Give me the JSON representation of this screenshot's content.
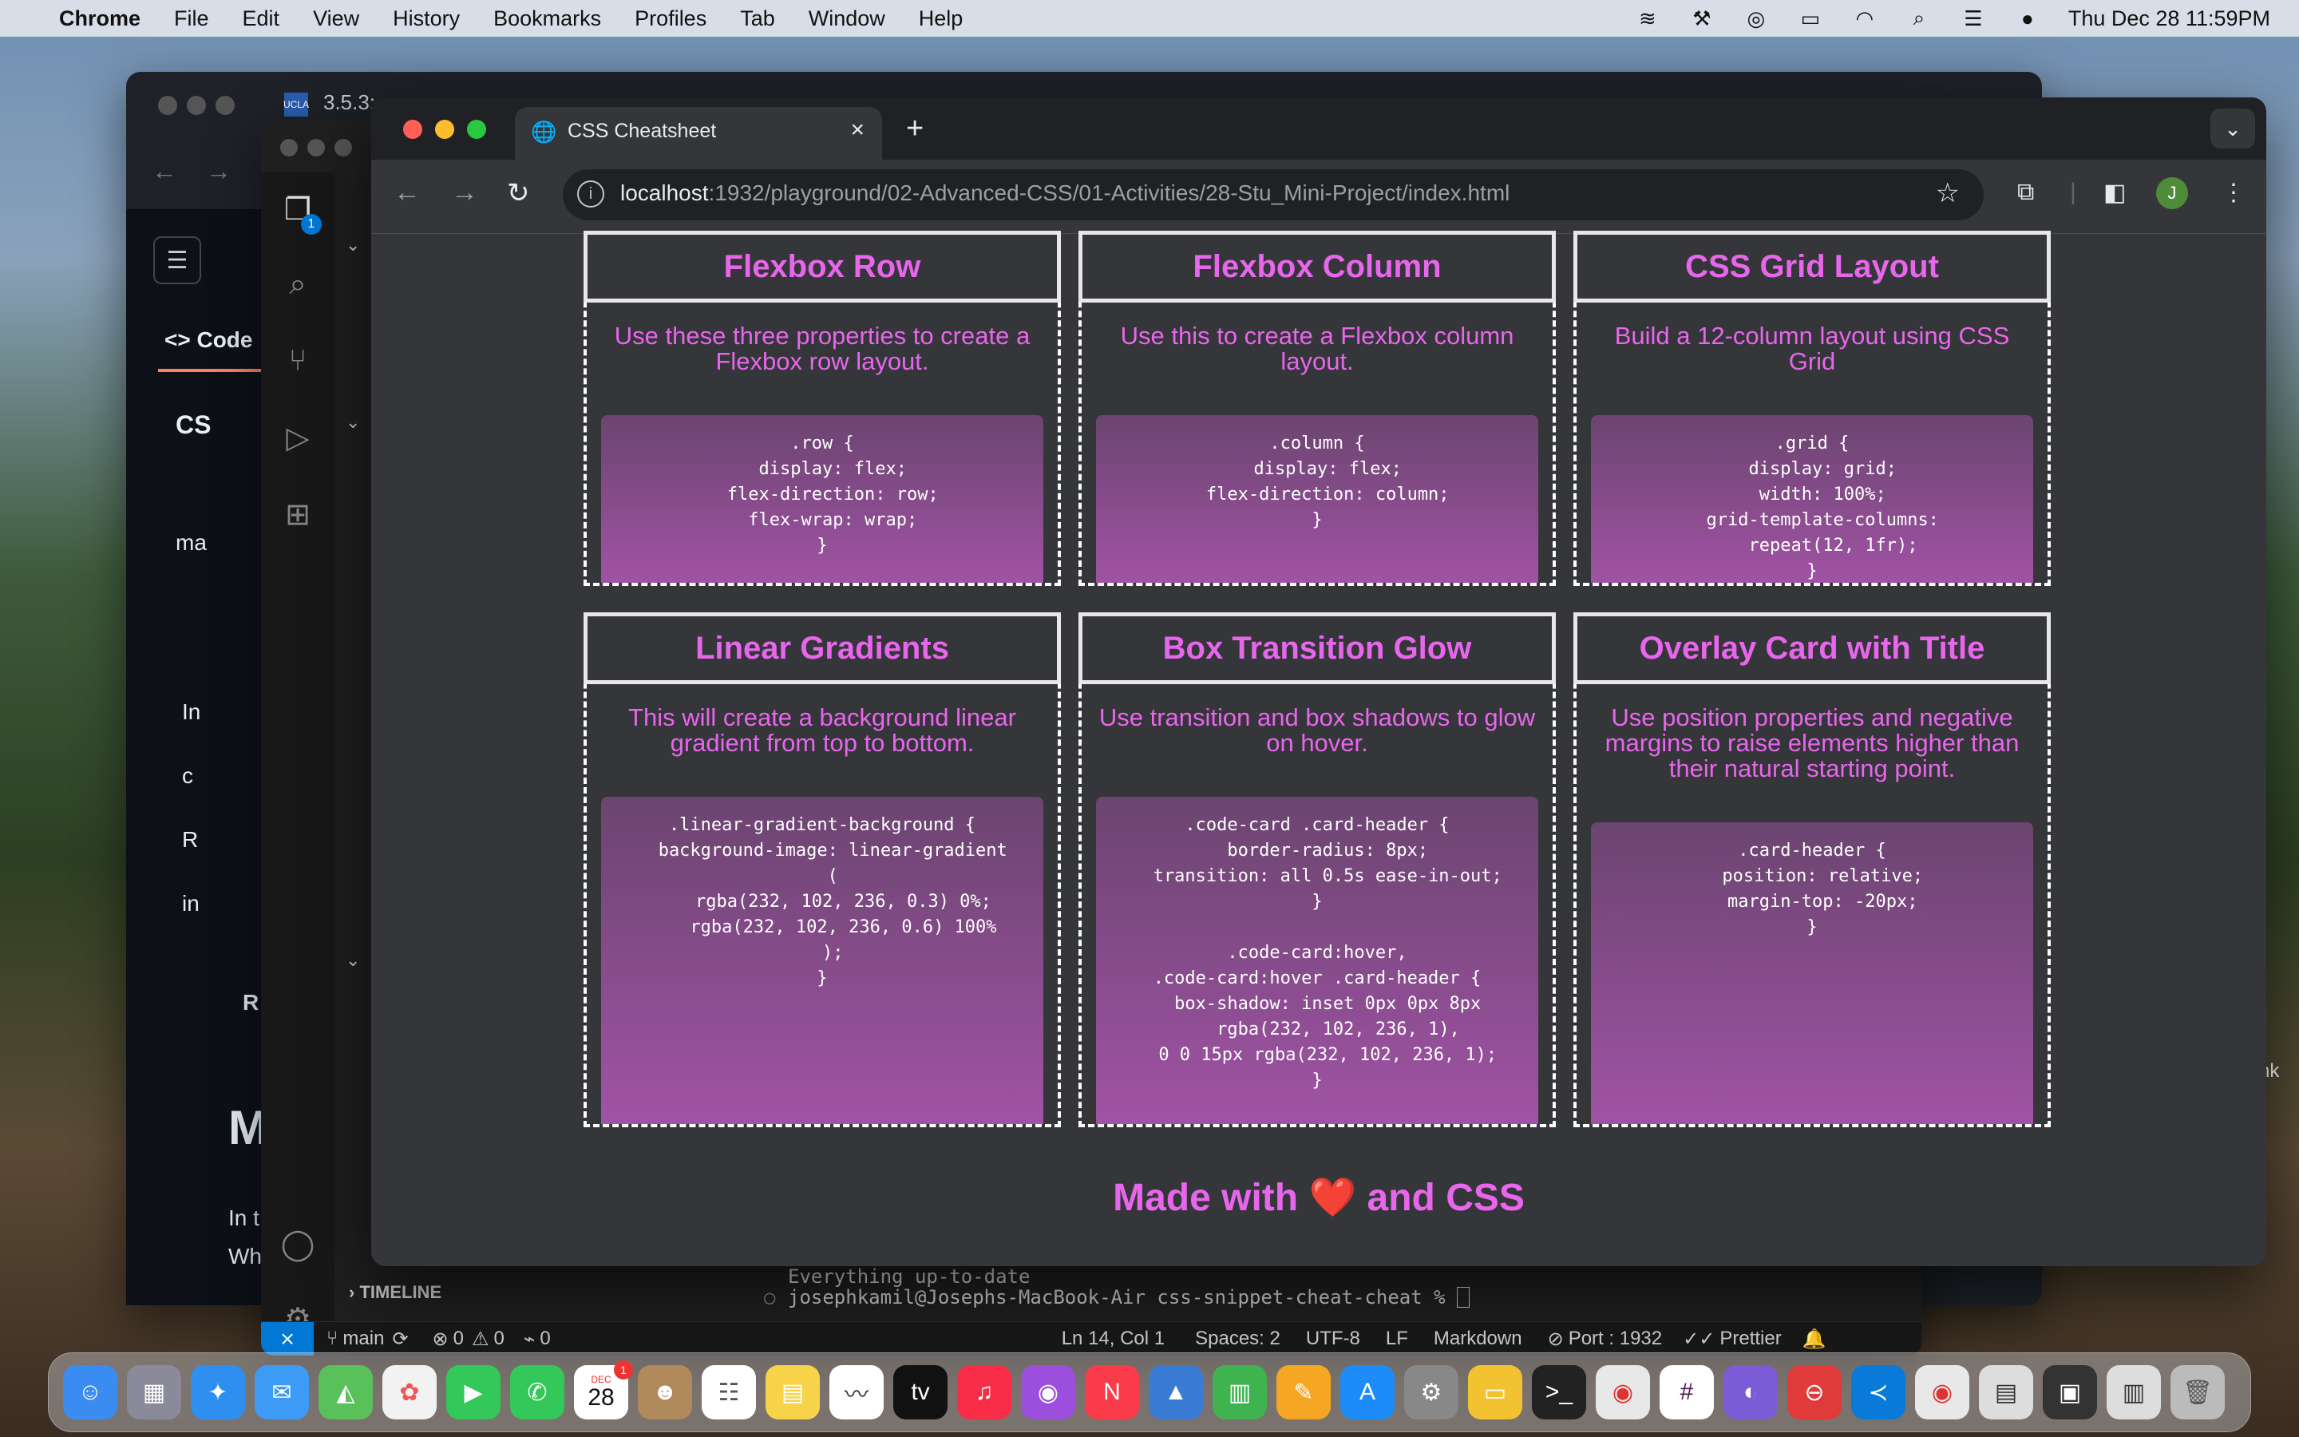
{
  "menubar": {
    "app": "Chrome",
    "items": [
      "File",
      "Edit",
      "View",
      "History",
      "Bookmarks",
      "Profiles",
      "Tab",
      "Window",
      "Help"
    ],
    "datetime": "Thu Dec 28  11:59PM"
  },
  "background_windows": {
    "tab_text": "3.5.3:",
    "github_code_tab": "Code",
    "github_repo_prefix": "CS",
    "github_branch_prefix": "ma",
    "github_files": [
      "In",
      "c",
      "R",
      "in"
    ],
    "github_readme_prefix": "R",
    "github_heading_prefix": "M",
    "github_text_1": "In t",
    "github_text_2": "Wh",
    "right_edge_text": "nk"
  },
  "vscode": {
    "explorer_badge": "1",
    "timeline_label": "TIMELINE",
    "terminal_line_1": "Everything up-to-date",
    "terminal_line_2": "josephkamil@Josephs-MacBook-Air css-snippet-cheat-cheat % ",
    "status": {
      "branch": "main",
      "errors": "0",
      "warnings": "0",
      "ports": "0",
      "position": "Ln 14, Col 1",
      "spaces": "Spaces: 2",
      "encoding": "UTF-8",
      "eol": "LF",
      "language": "Markdown",
      "port": "Port : 1932",
      "formatter": "Prettier"
    }
  },
  "chrome": {
    "tab_title": "CSS Cheatsheet",
    "url_host": "localhost",
    "url_path": ":1932/playground/02-Advanced-CSS/01-Activities/28-Stu_Mini-Project/index.html",
    "profile_initial": "J"
  },
  "cards": [
    {
      "title": "Flexbox Row",
      "desc": "Use these three properties to create a Flexbox row layout.",
      "code": ".row {\n  display: flex;\n  flex-direction: row;\n  flex-wrap: wrap;\n}"
    },
    {
      "title": "Flexbox Column",
      "desc": "Use this to create a Flexbox column layout.",
      "code": ".column {\n  display: flex;\n  flex-direction: column;\n}"
    },
    {
      "title": "CSS Grid Layout",
      "desc": "Build a 12-column layout using CSS Grid",
      "code": ".grid {\n  display: grid;\n  width: 100%;\n  grid-template-columns:\n    repeat(12, 1fr);\n}"
    },
    {
      "title": "Linear Gradients",
      "desc": "This will create a background linear gradient from top to bottom.",
      "code": ".linear-gradient-background {\n  background-image: linear-gradient\n  (\n    rgba(232, 102, 236, 0.3) 0%;\n    rgba(232, 102, 236, 0.6) 100%\n  );\n}"
    },
    {
      "title": "Box Transition Glow",
      "desc": "Use transition and box shadows to glow on hover.",
      "code": ".code-card .card-header {\n  border-radius: 8px;\n  transition: all 0.5s ease-in-out;\n}\n\n.code-card:hover,\n.code-card:hover .card-header {\n  box-shadow: inset 0px 0px 8px\n    rgba(232, 102, 236, 1),\n  0 0 15px rgba(232, 102, 236, 1);\n}"
    },
    {
      "title": "Overlay Card with Title",
      "desc": "Use position properties and negative margins to raise elements higher than their natural starting point.",
      "code": ".card-header {\n  position: relative;\n  margin-top: -20px;\n}"
    }
  ],
  "footer": "Made with ❤️ and CSS",
  "dock": {
    "calendar_month": "DEC",
    "calendar_day": "28",
    "calendar_badge": "1"
  },
  "colors": {
    "accent": "#e866ec",
    "page_bg": "#35363a"
  }
}
